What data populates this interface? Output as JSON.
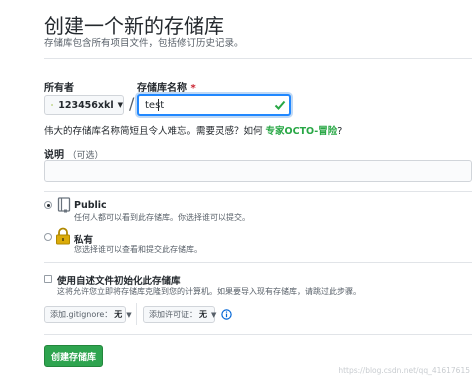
{
  "header": {
    "title": "创建一个新的存储库",
    "subtitle": "存储库包含所有项目文件，包括修订历史记录。"
  },
  "owner": {
    "label": "所有者",
    "value": "123456xkl"
  },
  "repo_name": {
    "label": "存储库名称",
    "required_mark": "*",
    "value": "test",
    "valid": true
  },
  "hint": {
    "text": "伟大的存储库名称简短且令人难忘。需要灵感？如何 ",
    "link": "专家OCTO-冒险",
    "end": "?"
  },
  "description": {
    "label": "说明",
    "optional": "（可选）",
    "value": ""
  },
  "visibility": {
    "public_title": "Public",
    "public_desc": "任何人都可以看到此存储库。你选择谁可以提交。",
    "private_title": "私有",
    "private_desc": "您选择谁可以查看和提交此存储库。",
    "selected": "public"
  },
  "init": {
    "label": "使用自述文件初始化此存储库",
    "desc": "这将允许您立即将存储库克隆到您的计算机。如果要导入现有存储库，请跳过此步骤。",
    "checked": false
  },
  "gitignore": {
    "label": "添加.gitignore：",
    "value": "无"
  },
  "license": {
    "label": "添加许可证：",
    "value": "无"
  },
  "create_button": "创建存储库",
  "watermark": "https://blog.csdn.net/qq_41617615",
  "colors": {
    "accent_green": "#2ea44f",
    "focus_blue": "#2188ff",
    "link_green": "#28a745",
    "required_red": "#cb2431"
  },
  "icons": {
    "owner_avatar": "identicon",
    "valid": "check-icon",
    "public": "repo-book-icon",
    "private": "lock-icon",
    "info": "info-icon",
    "dropdown": "caret-down-icon"
  }
}
